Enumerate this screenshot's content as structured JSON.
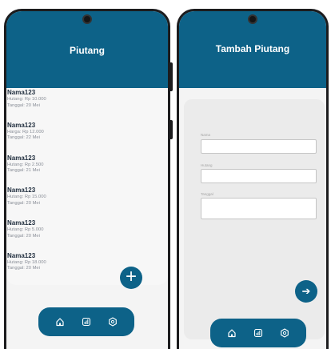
{
  "list_screen": {
    "title": "Piutang",
    "items": [
      {
        "name": "Nama123",
        "line1": "Hutang: Rp 10.000",
        "line2": "Tanggal: 20 Mei"
      },
      {
        "name": "Nama123",
        "line1": "Harga: Rp 12.000",
        "line2": "Tanggal: 22 Mei"
      },
      {
        "name": "Nama123",
        "line1": "Hutang: Rp 2.500",
        "line2": "Tanggal: 21 Mei"
      },
      {
        "name": "Nama123",
        "line1": "Hutang: Rp 15.000",
        "line2": "Tanggal: 20 Mei"
      },
      {
        "name": "Nama123",
        "line1": "Hutang: Rp 5.000",
        "line2": "Tanggal: 20 Mei"
      },
      {
        "name": "Nama123",
        "line1": "Hutang: Rp 18.000",
        "line2": "Tanggal: 20 Mei"
      }
    ],
    "fab_icon": "plus-icon",
    "fab_symbol": "+"
  },
  "form_screen": {
    "title": "Tambah Piutang",
    "fields": [
      {
        "label": "Nama",
        "value": ""
      },
      {
        "label": "Hutang",
        "value": ""
      },
      {
        "label": "Tanggal",
        "value": ""
      }
    ],
    "submit_icon": "arrow-right-icon",
    "submit_symbol": "➔"
  },
  "bottom_nav": {
    "items": [
      {
        "icon": "home-icon"
      },
      {
        "icon": "chart-icon"
      },
      {
        "icon": "settings-icon"
      }
    ]
  },
  "colors": {
    "primary": "#0d6288",
    "background": "#f7f7f7",
    "form_background": "#ebebeb"
  }
}
